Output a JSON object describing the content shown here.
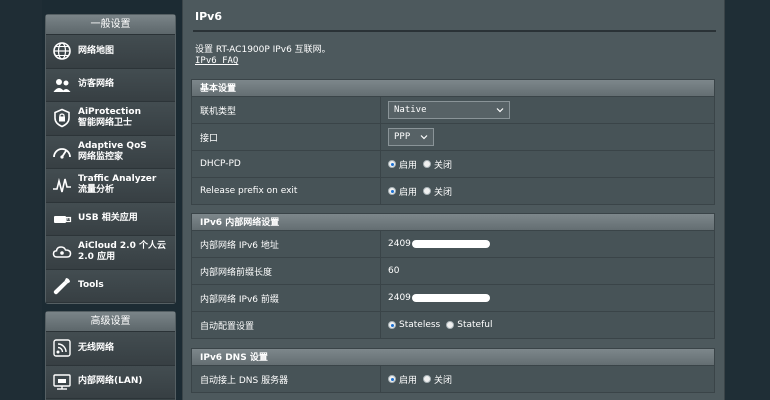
{
  "sidebar": {
    "general_header": "一般设置",
    "general_items": [
      {
        "icon": "network-map-icon",
        "lines": [
          "网络地图"
        ]
      },
      {
        "icon": "guest-network-icon",
        "lines": [
          "访客网络"
        ]
      },
      {
        "icon": "aiprotection-icon",
        "lines": [
          "AiProtection",
          "智能网络卫士"
        ]
      },
      {
        "icon": "qos-icon",
        "lines": [
          "Adaptive QoS",
          "网络监控家"
        ]
      },
      {
        "icon": "traffic-analyzer-icon",
        "lines": [
          "Traffic Analyzer",
          "流量分析"
        ]
      },
      {
        "icon": "usb-icon",
        "lines": [
          "USB 相关应用"
        ]
      },
      {
        "icon": "aicloud-icon",
        "lines": [
          "AiCloud 2.0 个人云",
          "2.0 应用"
        ]
      },
      {
        "icon": "tools-icon",
        "lines": [
          "Tools"
        ]
      }
    ],
    "advanced_header": "高级设置",
    "advanced_items": [
      {
        "icon": "wireless-icon",
        "lines": [
          "无线网络"
        ]
      },
      {
        "icon": "lan-icon",
        "lines": [
          "内部网络(LAN)"
        ]
      }
    ]
  },
  "main": {
    "title": "IPv6",
    "description": "设置 RT-AC1900P IPv6 互联网。",
    "faq_link": "IPv6 FAQ",
    "sections": {
      "basic": {
        "header": "基本设置",
        "connection_type": {
          "label": "联机类型",
          "value": "Native"
        },
        "interface": {
          "label": "接口",
          "value": "PPP"
        },
        "dhcp_pd": {
          "label": "DHCP-PD",
          "on": "启用",
          "off": "关闭"
        },
        "release_prefix": {
          "label": "Release prefix on exit",
          "on": "启用",
          "off": "关闭"
        }
      },
      "lan": {
        "header": "IPv6 内部网络设置",
        "lan_address": {
          "label": "内部网络 IPv6 地址",
          "value_prefix": "2409"
        },
        "prefix_length": {
          "label": "内部网络前缀长度",
          "value": "60"
        },
        "lan_prefix": {
          "label": "内部网络 IPv6 前缀",
          "value_prefix": "2409"
        },
        "auto_config": {
          "label": "自动配置设置",
          "option1": "Stateless",
          "option2": "Stateful"
        }
      },
      "dns": {
        "header": "IPv6 DNS 设置",
        "auto_dns": {
          "label": "自动接上 DNS 服务器",
          "on": "启用",
          "off": "关闭"
        }
      }
    }
  },
  "colors": {
    "background": "#1c2b33",
    "panel": "#4d595d",
    "row": "#475357",
    "header": "#646e72",
    "radio_selected": "#1a6fd1"
  }
}
